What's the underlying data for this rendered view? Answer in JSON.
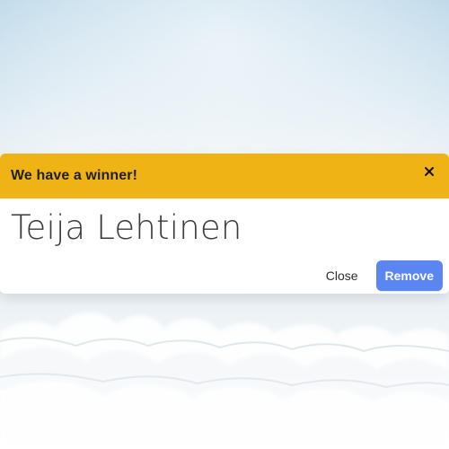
{
  "modal": {
    "header_title": "We have a winner!",
    "winner_name": "Teija Lehtinen",
    "close_label": "Close",
    "remove_label": "Remove",
    "close_icon": "close-icon"
  },
  "theme": {
    "header_background": "#f0b316",
    "primary_button": "#5b85f0"
  }
}
